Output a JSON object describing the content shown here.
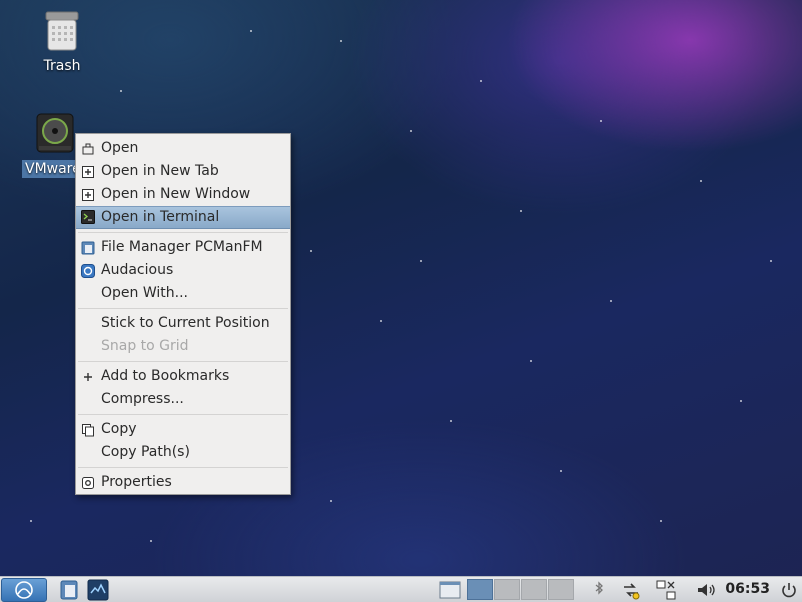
{
  "desktop": {
    "icons": [
      {
        "label": "Trash",
        "icon": "trash-icon"
      },
      {
        "label": "VMware T",
        "icon": "disc-drive-icon"
      }
    ]
  },
  "context_menu": {
    "items": [
      {
        "label": "Open",
        "icon": "open-folder-icon"
      },
      {
        "label": "Open in New Tab",
        "icon": "new-tab-icon"
      },
      {
        "label": "Open in New Window",
        "icon": "new-window-icon"
      },
      {
        "label": "Open in Terminal",
        "icon": "terminal-icon",
        "highlighted": true
      },
      {
        "label": "File Manager PCManFM",
        "icon": "file-manager-icon"
      },
      {
        "label": "Audacious",
        "icon": "audacious-icon"
      },
      {
        "label": "Open With...",
        "icon": ""
      },
      {
        "label": "Stick to Current Position",
        "icon": ""
      },
      {
        "label": "Snap to Grid",
        "icon": "",
        "disabled": true
      },
      {
        "label": "Add to Bookmarks",
        "icon": "plus-icon"
      },
      {
        "label": "Compress...",
        "icon": ""
      },
      {
        "label": "Copy",
        "icon": "copy-icon"
      },
      {
        "label": "Copy Path(s)",
        "icon": ""
      },
      {
        "label": "Properties",
        "icon": "properties-icon"
      }
    ]
  },
  "taskbar": {
    "clock": "06:53",
    "workspaces": 4,
    "active_workspace": 1,
    "launchers": [
      "file-manager-icon",
      "application-icon"
    ],
    "tray": [
      "bluetooth-icon",
      "updates-icon",
      "network-icon",
      "volume-icon"
    ]
  },
  "colors": {
    "menu_bg": "#f0efee",
    "menu_highlight": "#95b3d1",
    "selection": "#4c76a6",
    "taskbar_bg": "#d9dcdf"
  }
}
